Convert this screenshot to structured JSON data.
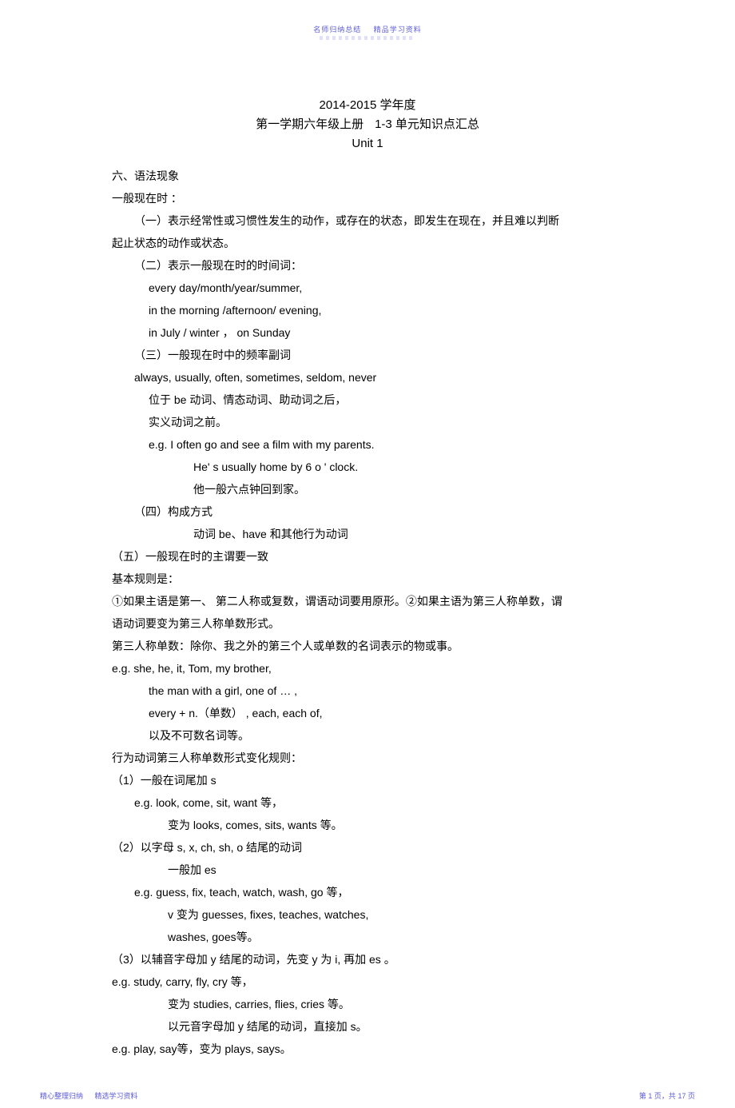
{
  "header": {
    "left": "名师归纳总结",
    "right": "精品学习资料"
  },
  "title": {
    "year": "2014-2015 学年度",
    "line2a": "第一学期六年级上册",
    "line2b": "1-3 单元知识点汇总",
    "unit": "Unit 1"
  },
  "body": {
    "l01": "六、语法现象",
    "l02": "一般现在时    ：",
    "l03": "（一）表示经常性或习惯性发生的动作，或存在的状态，即发生在现在，并且难以判断",
    "l04": "起止状态的动作或状态。",
    "l05": "（二）表示一般现在时的时间词：",
    "l06": "every day/month/year/summer,",
    "l07": "in the morning /afternoon/ evening,",
    "l08": "in July / winter ， on Sunday",
    "l09": "（三）一般现在时中的频率副词",
    "l10": "always, usually, often, sometimes, seldom, never",
    "l11": "位于  be 动词、情态动词、助动词之后，",
    "l12": "实义动词之前。",
    "l13": "e.g. I often go and see a film with my parents.",
    "l14": "He' s usually home by 6 o        ' clock.",
    "l15": "他一般六点钟回到家。",
    "l16": "（四）构成方式",
    "l17": "动词  be、have 和其他行为动词",
    "l18": "（五）一般现在时的主谓要一致",
    "l19": "基本规则是：",
    "l20": "①如果主语是第一、   第二人称或复数，谓语动词要用原形。②如果主语为第三人称单数，谓",
    "l21": "语动词要变为第三人称单数形式。",
    "l22": "第三人称单数：除你、我之外的第三个人或单数的名词表示的物或事。",
    "l23": "e.g. she, he, it, Tom, my brother,",
    "l24": "the man with a girl, one of            … ,",
    "l25": "every + n.（单数）  , each, each of,",
    "l26": "以及不可数名词等。",
    "l27": "行为动词第三人称单数形式变化规则：",
    "l28": "（1）一般在词尾加    s",
    "l29": "e.g. look, come, sit, want  等，",
    "l30": "变为  looks, comes, sits, wants 等。",
    "l31": "（2）以字母  s, x, ch, sh, o 结尾的动词",
    "l32": "一般加  es",
    "l33": "e.g. guess, fix, teach, watch, wash, go  等，",
    "l34": "v 变为  guesses, fixes, teaches, watches,",
    "l35": "washes, goes等。",
    "l36": "（3）以辅音字母加    y 结尾的动词，先变    y 为 i,  再加  es 。",
    "l37": "e.g. study, carry, fly, cry 等，",
    "l38": "变为  studies, carries, flies, cries  等。",
    "l39": "以元音字母加    y 结尾的动词，直接加    s。",
    "l40": "e.g. play, say等，变为   plays, says。"
  },
  "footer": {
    "leftA": "精心整理归纳",
    "leftB": "精选学习资料",
    "rightPrefix": "第",
    "rightPage": "1",
    "rightMid": "页，共",
    "rightTotal": "17",
    "rightSuffix": "页"
  }
}
